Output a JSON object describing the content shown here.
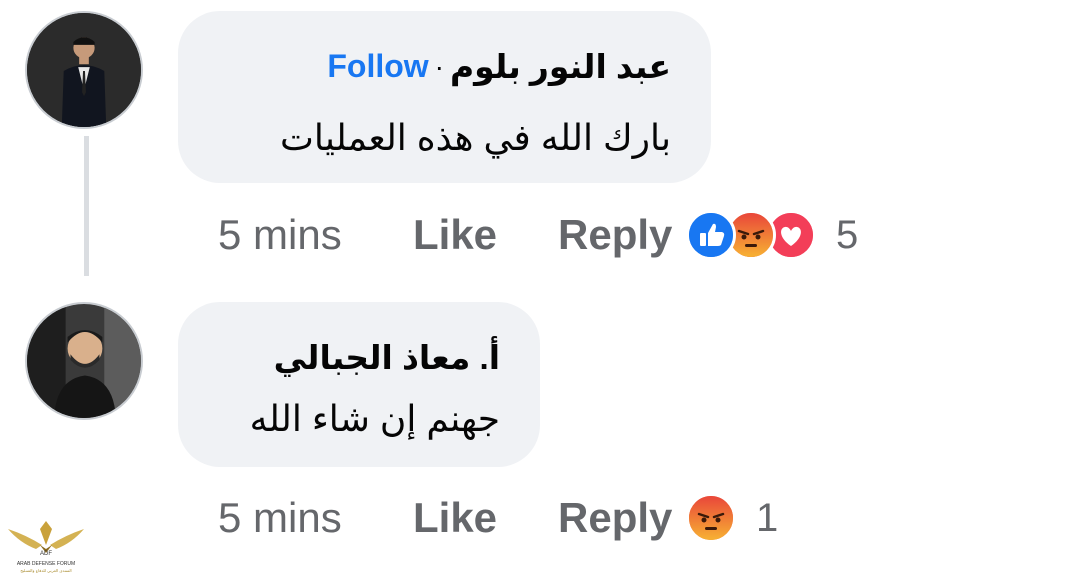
{
  "comments": [
    {
      "author": "عبد النور بلوم",
      "separator": "·",
      "follow_label": "Follow",
      "text": "بارك الله في هذه العمليات",
      "time": "5 mins",
      "like_label": "Like",
      "reply_label": "Reply",
      "reactions": [
        "like-icon",
        "angry-icon",
        "love-icon"
      ],
      "reaction_count": "5"
    },
    {
      "author": "أ. معاذ الجبالي",
      "text": "جهنم إن شاء الله",
      "time": "5 mins",
      "like_label": "Like",
      "reply_label": "Reply",
      "reactions": [
        "angry-icon"
      ],
      "reaction_count": "1"
    }
  ],
  "colors": {
    "bubble": "#f0f2f5",
    "follow": "#1877f2",
    "muted": "#65676b",
    "like_reaction": "#1877f2",
    "angry_reaction": "#f25c2a",
    "love_reaction": "#f33e58"
  },
  "watermark": {
    "title": "ARAB DEFENSE FORUM",
    "subtitle": "المنتدى العربي للدفاع والتسليح"
  }
}
